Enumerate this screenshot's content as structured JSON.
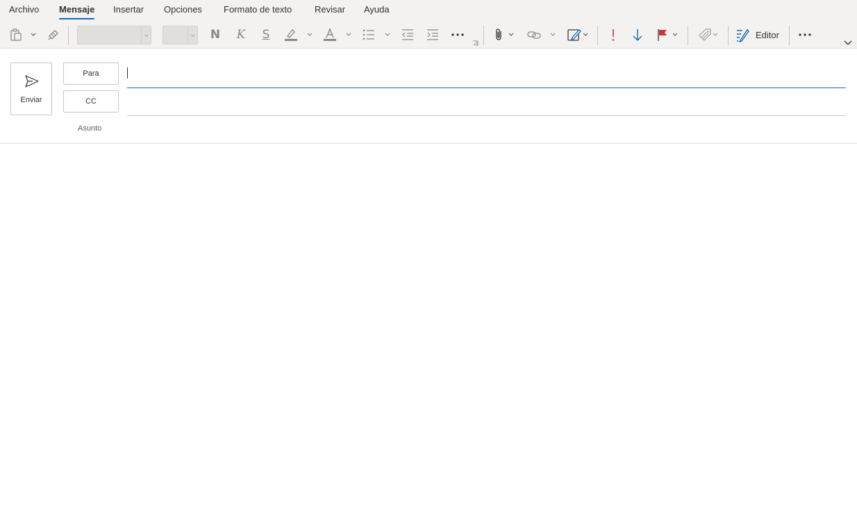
{
  "ribbon": {
    "tabs": [
      {
        "label": "Archivo"
      },
      {
        "label": "Mensaje"
      },
      {
        "label": "Insertar"
      },
      {
        "label": "Opciones"
      },
      {
        "label": "Formato de texto"
      },
      {
        "label": "Revisar"
      },
      {
        "label": "Ayuda"
      }
    ],
    "active_tab": "Mensaje"
  },
  "toolbar": {
    "font_name": "",
    "font_size": "",
    "bold_glyph": "N",
    "italic_glyph": "K",
    "underline_glyph": "S",
    "editor_label": "Editor",
    "icons": [
      "paste-icon",
      "format-painter-icon",
      "bold-icon",
      "italic-icon",
      "underline-icon",
      "highlight-icon",
      "font-color-icon",
      "bullets-icon",
      "decrease-indent-icon",
      "increase-indent-icon",
      "more-icon",
      "attach-icon",
      "link-icon",
      "signature-icon",
      "high-importance-icon",
      "low-importance-icon",
      "flag-icon",
      "sensitivity-icon",
      "editor-icon",
      "more-options-icon",
      "collapse-ribbon-icon"
    ],
    "colors": {
      "accent": "#0f6cbd",
      "importance": "#d13438",
      "low": "#0f6cbd",
      "flag": "#d13438"
    }
  },
  "compose": {
    "send_label": "Enviar",
    "to_label": "Para",
    "cc_label": "CC",
    "subject_label": "Asunto",
    "to_value": "",
    "cc_value": "",
    "subject_value": ""
  }
}
